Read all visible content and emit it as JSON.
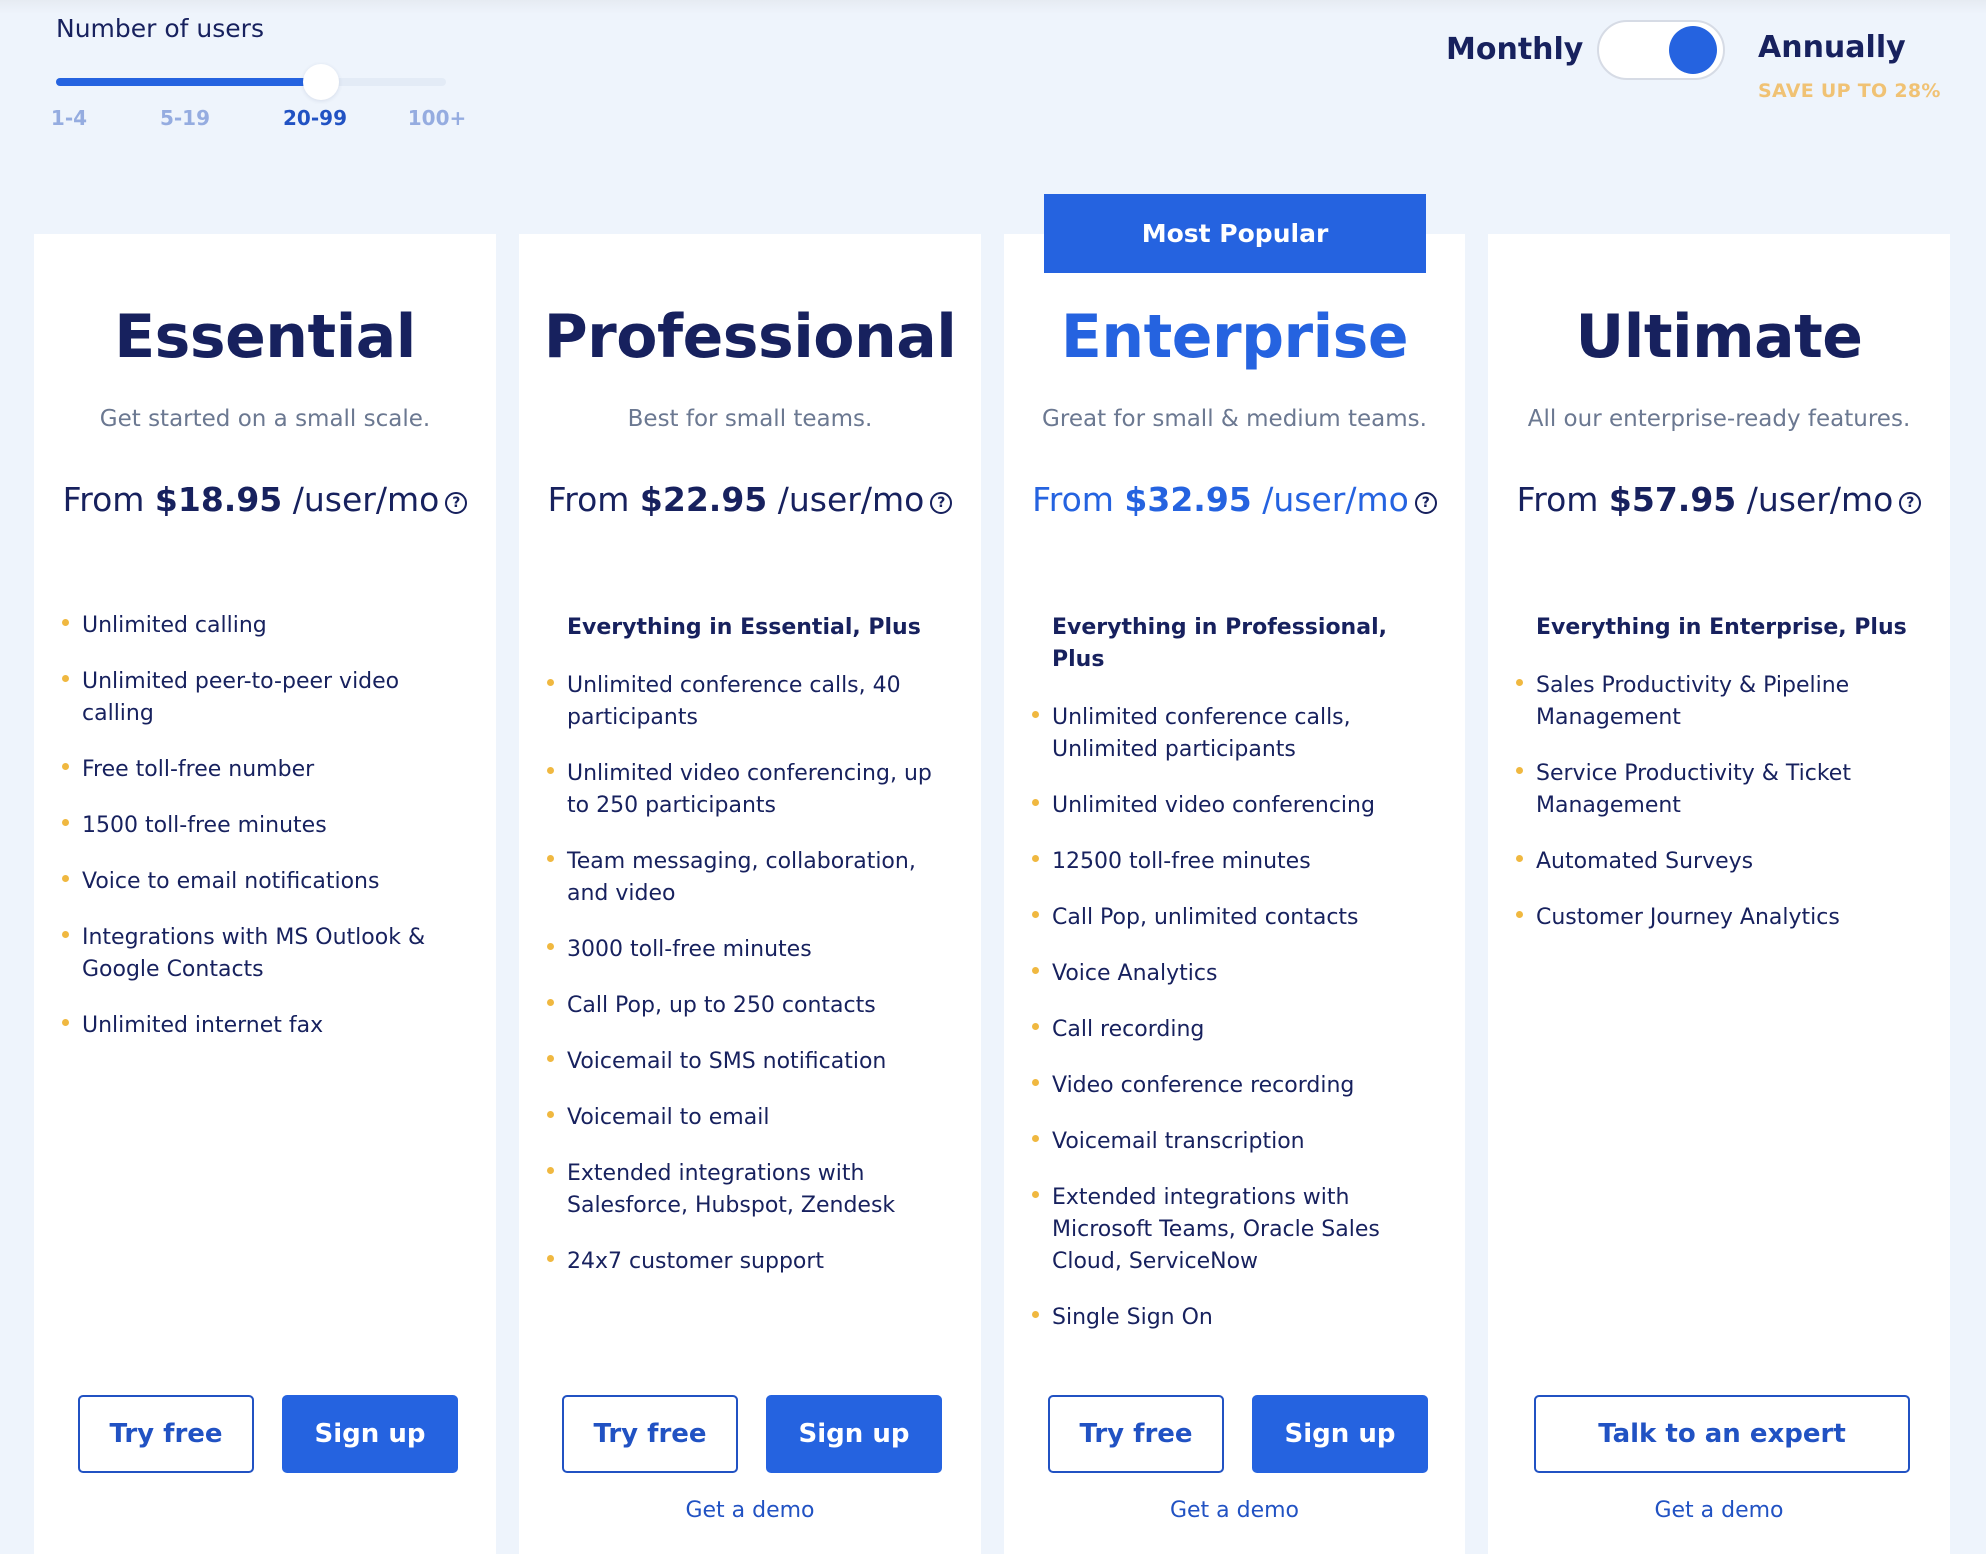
{
  "users_selector": {
    "label": "Number of users",
    "options": [
      "1-4",
      "5-19",
      "20-99",
      "100+"
    ],
    "selected_index": 2,
    "slider_fraction": 0.68
  },
  "billing": {
    "monthly_label": "Monthly",
    "annually_label": "Annually",
    "selected": "Annually",
    "save_badge": "SAVE UP TO 28%"
  },
  "colors": {
    "accent": "#2563e0",
    "navy": "#17215e",
    "bullet": "#f0b840",
    "save_badge": "#f0c274",
    "background": "#eef4fc"
  },
  "plans": [
    {
      "name": "Essential",
      "tagline": "Get started on a small scale.",
      "price_prefix": "From",
      "price": "$18.95",
      "price_unit": "/user/mo",
      "help_icon": "question-circle-icon",
      "features_heading": "",
      "features": [
        "Unlimited calling",
        "Unlimited peer-to-peer video calling",
        "Free toll-free number",
        "1500 toll-free minutes",
        "Voice to email notifications",
        "Integrations with MS Outlook & Google Contacts",
        "Unlimited internet fax"
      ],
      "primary_button": "Try free",
      "secondary_button": "Sign up",
      "demo_link": ""
    },
    {
      "name": "Professional",
      "tagline": "Best for small teams.",
      "price_prefix": "From",
      "price": "$22.95",
      "price_unit": "/user/mo",
      "help_icon": "question-circle-icon",
      "features_heading": "Everything in Essential, Plus",
      "features": [
        "Unlimited conference calls, 40 participants",
        "Unlimited video conferencing, up to 250 participants",
        "Team messaging, collaboration, and video",
        "3000 toll-free minutes",
        "Call Pop, up to 250 contacts",
        "Voicemail to SMS notification",
        "Voicemail to email",
        "Extended integrations with Salesforce, Hubspot, Zendesk",
        "24x7 customer support"
      ],
      "primary_button": "Try free",
      "secondary_button": "Sign up",
      "demo_link": "Get a demo"
    },
    {
      "name": "Enterprise",
      "badge": "Most Popular",
      "tagline": "Great for small & medium teams.",
      "price_prefix": "From",
      "price": "$32.95",
      "price_unit": "/user/mo",
      "help_icon": "question-circle-icon",
      "features_heading": "Everything in Professional, Plus",
      "features": [
        "Unlimited conference calls, Unlimited participants",
        "Unlimited video conferencing",
        "12500 toll-free minutes",
        "Call Pop, unlimited contacts",
        "Voice Analytics",
        "Call recording",
        "Video conference recording",
        "Voicemail transcription",
        "Extended integrations with Microsoft Teams, Oracle Sales Cloud, ServiceNow",
        "Single Sign On"
      ],
      "primary_button": "Try free",
      "secondary_button": "Sign up",
      "demo_link": "Get a demo"
    },
    {
      "name": "Ultimate",
      "tagline": "All our enterprise-ready features.",
      "price_prefix": "From",
      "price": "$57.95",
      "price_unit": "/user/mo",
      "help_icon": "question-circle-icon",
      "features_heading": "Everything in Enterprise, Plus",
      "features": [
        "Sales Productivity & Pipeline Management",
        "Service Productivity & Ticket Management",
        "Automated Surveys",
        "Customer Journey Analytics"
      ],
      "primary_button": "Talk to an expert",
      "secondary_button": "",
      "demo_link": "Get a demo"
    }
  ]
}
